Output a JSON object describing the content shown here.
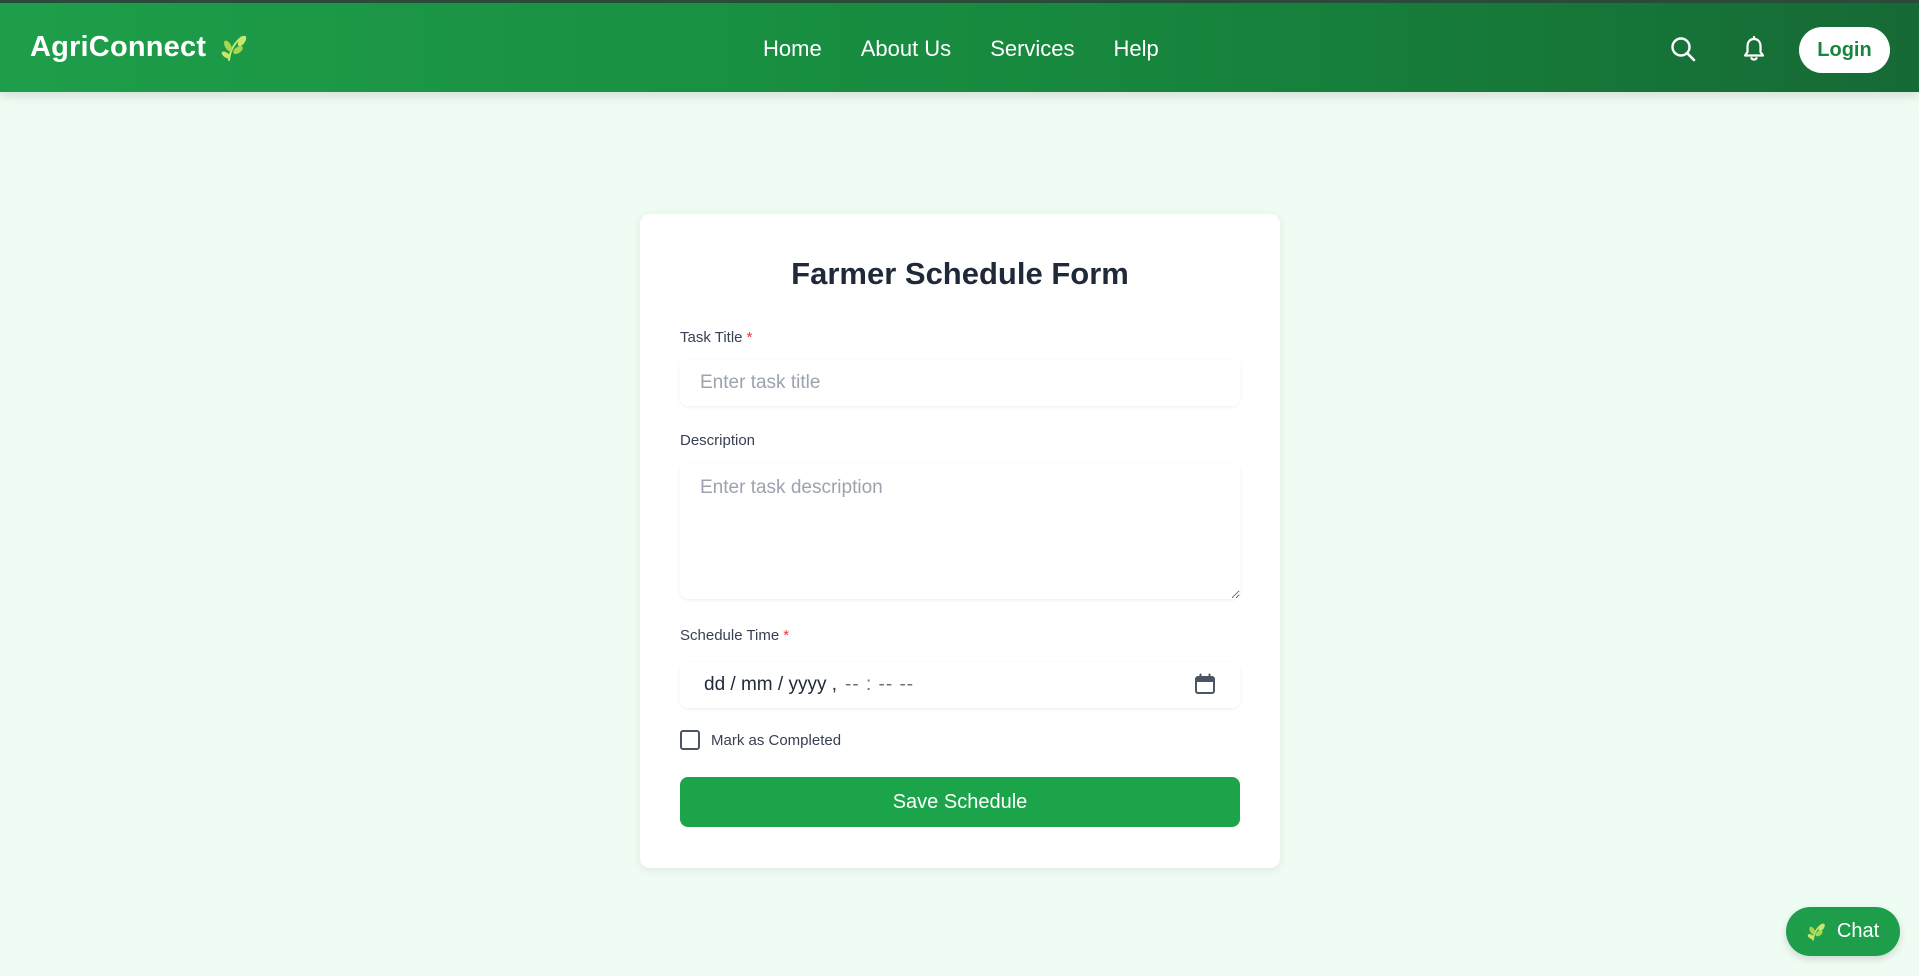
{
  "header": {
    "brand": "AgriConnect",
    "brand_icon": "leaf-icon",
    "nav": [
      "Home",
      "About Us",
      "Services",
      "Help"
    ],
    "search_icon": "search-icon",
    "notification_icon": "bell-icon",
    "login_label": "Login"
  },
  "form": {
    "title": "Farmer Schedule Form",
    "task_title": {
      "label": "Task Title",
      "required_mark": "*",
      "placeholder": "Enter task title"
    },
    "description": {
      "label": "Description",
      "placeholder": "Enter task description"
    },
    "schedule_time": {
      "label": "Schedule Time",
      "required_mark": "*",
      "date_placeholder": "dd / mm / yyyy ,",
      "time_placeholder": "-- : --  --",
      "calendar_icon": "calendar-icon"
    },
    "completed": {
      "label": "Mark as Completed",
      "checked": false
    },
    "submit_label": "Save Schedule"
  },
  "chat": {
    "label": "Chat",
    "icon": "leaf-icon"
  },
  "colors": {
    "primary": "#1ba44a",
    "header_start": "#1e9e4a",
    "header_end": "#166a35",
    "page_bg": "#effcf3",
    "required": "#e53935"
  }
}
